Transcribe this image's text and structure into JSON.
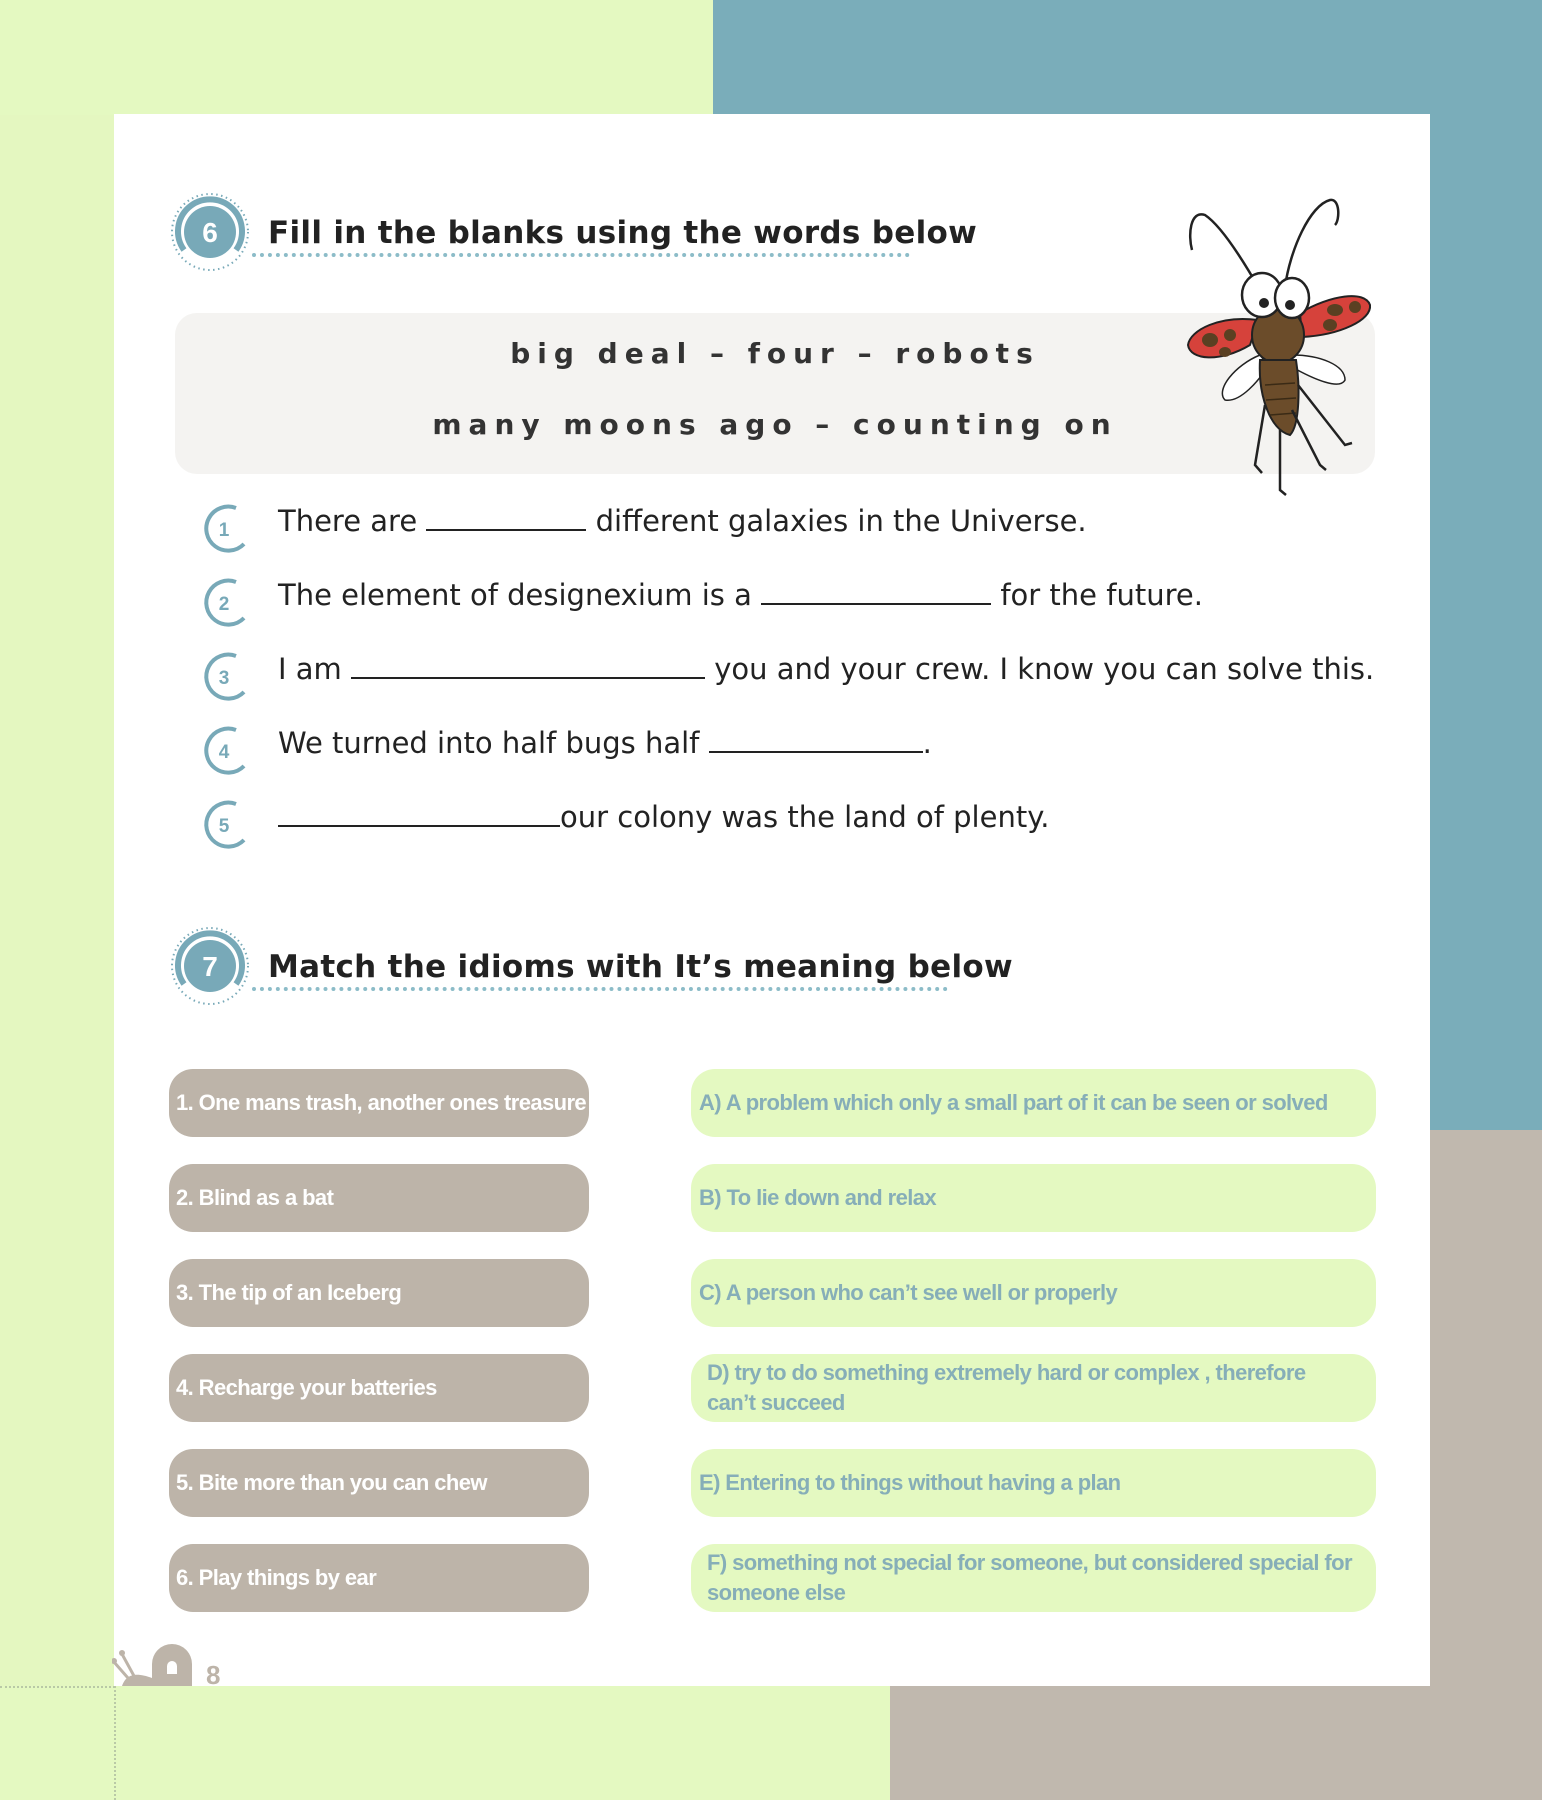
{
  "section6": {
    "number": "6",
    "title": "Fill in the blanks using the words below",
    "word_bank": [
      "big deal – four – robots",
      "many moons ago – counting on"
    ],
    "questions": [
      {
        "num": "1",
        "before": "There are ",
        "after": " different galaxies in the Universe."
      },
      {
        "num": "2",
        "before": "The element of designexium is a ",
        "after": " for the future."
      },
      {
        "num": "3",
        "before": "I am ",
        "after": " you and your crew. I know you can solve this."
      },
      {
        "num": "4",
        "before": "We turned into half bugs half ",
        "after": "."
      },
      {
        "num": "5",
        "before": "",
        "after": "our colony was the land of plenty."
      }
    ]
  },
  "section7": {
    "number": "7",
    "title": "Match the idioms with It’s meaning below",
    "idioms": [
      "1. One mans trash, another ones treasure",
      "2. Blind as a bat",
      "3. The tip of an Iceberg",
      "4. Recharge your batteries",
      "5. Bite more than you can chew",
      "6. Play things by ear"
    ],
    "meanings": [
      "A) A problem which only a small part of it can be seen or solved",
      "B) To lie down and relax",
      "C) A person who can’t see well or properly",
      "D) try to do something extremely hard or complex , therefore can’t succeed",
      "E) Entering to things without having a plan",
      "F) something not special for someone, but considered special for someone else"
    ]
  },
  "page_number": "8",
  "colors": {
    "green": "#e4f9c1",
    "blue": "#7aadba",
    "taupe": "#bdb4a9",
    "teal_text": "#86aeb8",
    "badge": "#78a9b8"
  },
  "icons": [
    "ladybug-illustration",
    "snail-icon"
  ]
}
